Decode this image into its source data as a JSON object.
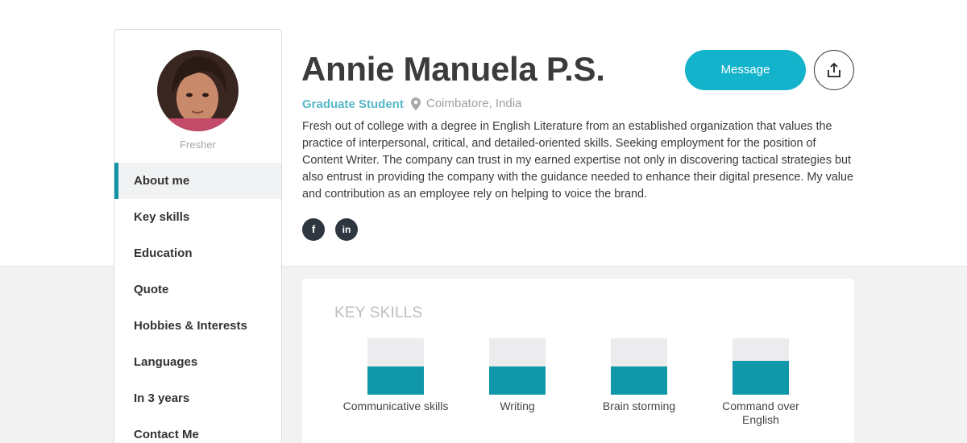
{
  "profile": {
    "name": "Annie Manuela P.S.",
    "role": "Graduate Student",
    "location": "Coimbatore, India",
    "status": "Fresher",
    "bio": "Fresh out of college with a degree in English Literature from an established organization that values the practice of interpersonal, critical, and detailed-oriented skills. Seeking employment for the position of Content Writer. The company can trust in my earned expertise not only in discovering tactical strategies but also entrust in providing the company with the guidance needed to enhance their digital presence. My value and contribution as an employee rely on helping to voice the brand."
  },
  "actions": {
    "message_label": "Message",
    "share_icon": "share-icon"
  },
  "social": {
    "facebook_glyph": "f",
    "linkedin_glyph": "in"
  },
  "sidebar": {
    "items": [
      {
        "label": "About me",
        "active": true
      },
      {
        "label": "Key skills"
      },
      {
        "label": "Education"
      },
      {
        "label": "Quote"
      },
      {
        "label": "Hobbies & Interests"
      },
      {
        "label": "Languages"
      },
      {
        "label": "In 3 years"
      },
      {
        "label": "Contact Me"
      }
    ]
  },
  "key_skills": {
    "title": "KEY SKILLS",
    "skills": [
      {
        "label": "Communicative skills",
        "level": 0.5
      },
      {
        "label": "Writing",
        "level": 0.5
      },
      {
        "label": "Brain storming",
        "level": 0.5
      },
      {
        "label": "Command over English",
        "level": 0.6
      }
    ]
  },
  "colors": {
    "accent": "#14b3cc",
    "bar_fill": "#1097aa",
    "active_marker": "#1293a5",
    "role_text": "#55b8c8"
  }
}
